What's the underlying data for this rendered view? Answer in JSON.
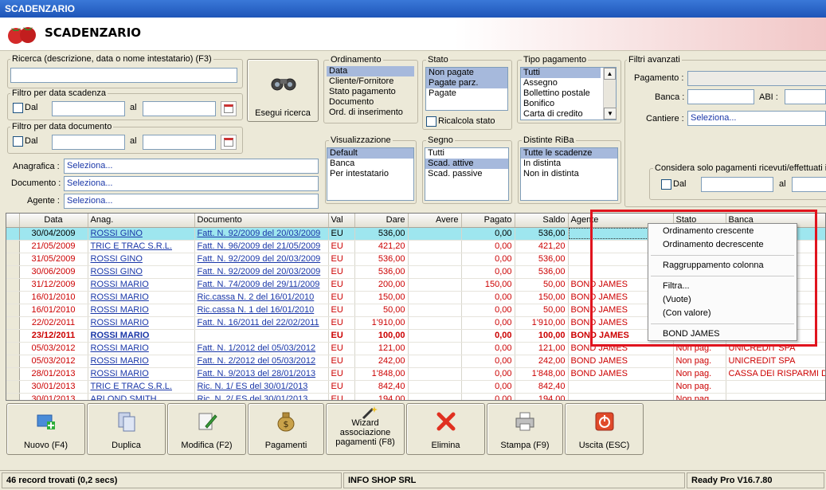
{
  "window": {
    "title": "SCADENZARIO"
  },
  "header": {
    "title": "SCADENZARIO"
  },
  "search": {
    "label": "Ricerca (descrizione, data o nome intestatario) (F3)",
    "value": "",
    "button_label": "Esegui ricerca"
  },
  "filter_due": {
    "label": "Filtro per data scadenza",
    "dal": "Dal",
    "al": "al"
  },
  "filter_doc": {
    "label": "Filtro per data documento",
    "dal": "Dal",
    "al": "al"
  },
  "anagrafica": {
    "label": "Anagrafica :",
    "value": "Seleziona..."
  },
  "documento": {
    "label": "Documento :",
    "value": "Seleziona..."
  },
  "agente": {
    "label": "Agente :",
    "value": "Seleziona..."
  },
  "ordinamento": {
    "label": "Ordinamento",
    "items": [
      "Data",
      "Cliente/Fornitore",
      "Stato pagamento",
      "Documento",
      "Ord. di inserimento"
    ],
    "selected": [
      0
    ]
  },
  "stato": {
    "label": "Stato",
    "items": [
      "Non pagate",
      "Pagate parz.",
      "Pagate"
    ],
    "selected": [
      0,
      1
    ],
    "ricalcola": "Ricalcola stato"
  },
  "tipo_pagamento": {
    "label": "Tipo pagamento",
    "items": [
      "Tutti",
      "Assegno",
      "Bollettino postale",
      "Bonifico",
      "Carta di credito"
    ],
    "selected": [
      0
    ]
  },
  "visualizzazione": {
    "label": "Visualizzazione",
    "items": [
      "Default",
      "Banca",
      "Per intestatario"
    ],
    "selected": [
      0
    ]
  },
  "segno": {
    "label": "Segno",
    "items": [
      "Tutti",
      "Scad. attive",
      "Scad. passive"
    ],
    "selected": [
      1
    ]
  },
  "distinte": {
    "label": "Distinte RiBa",
    "items": [
      "Tutte le scadenze",
      "In distinta",
      "Non in distinta"
    ],
    "selected": [
      0
    ]
  },
  "filtri_avanzati": {
    "label": "Filtri avanzati",
    "pagamento": "Pagamento :",
    "banca": "Banca :",
    "abi": "ABI :",
    "cantiere": "Cantiere :",
    "cantiere_value": "Seleziona...",
    "considera": "Considera solo pagamenti ricevuti/effettuati i",
    "dal": "Dal",
    "al": "al"
  },
  "grid": {
    "columns": [
      "Data",
      "Anag.",
      "Documento",
      "Val",
      "Dare",
      "Avere",
      "Pagato",
      "Saldo",
      "Agente",
      "Stato",
      "Banca"
    ],
    "rows": [
      {
        "data": "30/04/2009",
        "anag": "ROSSI GINO",
        "doc": "Fatt. N. 92/2009 del 20/03/2009",
        "val": "EU",
        "dare": "536,00",
        "avere": "",
        "pagato": "0,00",
        "saldo": "536,00",
        "agente": "",
        "stato": "",
        "banca": "",
        "style": "first"
      },
      {
        "data": "21/05/2009",
        "anag": "TRIC E TRAC S.R.L.",
        "doc": "Fatt. N. 96/2009 del 21/05/2009",
        "val": "EU",
        "dare": "421,20",
        "avere": "",
        "pagato": "0,00",
        "saldo": "421,20",
        "agente": "",
        "stato": "",
        "banca": "",
        "style": "r"
      },
      {
        "data": "31/05/2009",
        "anag": "ROSSI GINO",
        "doc": "Fatt. N. 92/2009 del 20/03/2009",
        "val": "EU",
        "dare": "536,00",
        "avere": "",
        "pagato": "0,00",
        "saldo": "536,00",
        "agente": "",
        "stato": "",
        "banca": "",
        "style": "r"
      },
      {
        "data": "30/06/2009",
        "anag": "ROSSI GINO",
        "doc": "Fatt. N. 92/2009 del 20/03/2009",
        "val": "EU",
        "dare": "536,00",
        "avere": "",
        "pagato": "0,00",
        "saldo": "536,00",
        "agente": "",
        "stato": "",
        "banca": "",
        "style": "r"
      },
      {
        "data": "31/12/2009",
        "anag": "ROSSI MARIO",
        "doc": "Fatt. N. 74/2009 del 29/11/2009",
        "val": "EU",
        "dare": "200,00",
        "avere": "",
        "pagato": "150,00",
        "saldo": "50,00",
        "agente": "BOND JAMES",
        "stato": "",
        "banca": "",
        "style": "r"
      },
      {
        "data": "16/01/2010",
        "anag": "ROSSI MARIO",
        "doc": "Ric.cassa N. 2 del 16/01/2010",
        "val": "EU",
        "dare": "150,00",
        "avere": "",
        "pagato": "0,00",
        "saldo": "150,00",
        "agente": "BOND JAMES",
        "stato": "",
        "banca": "",
        "style": "r"
      },
      {
        "data": "16/01/2010",
        "anag": "ROSSI MARIO",
        "doc": "Ric.cassa N. 1 del 16/01/2010",
        "val": "EU",
        "dare": "50,00",
        "avere": "",
        "pagato": "0,00",
        "saldo": "50,00",
        "agente": "BOND JAMES",
        "stato": "",
        "banca": "",
        "style": "r"
      },
      {
        "data": "22/02/2011",
        "anag": "ROSSI MARIO",
        "doc": "Fatt. N. 16/2011 del 22/02/2011",
        "val": "EU",
        "dare": "1'910,00",
        "avere": "",
        "pagato": "0,00",
        "saldo": "1'910,00",
        "agente": "BOND JAMES",
        "stato": "",
        "banca": "",
        "style": "r"
      },
      {
        "data": "23/12/2011",
        "anag": "ROSSI MARIO",
        "doc": "",
        "val": "EU",
        "dare": "100,00",
        "avere": "",
        "pagato": "0,00",
        "saldo": "100,00",
        "agente": "BOND JAMES",
        "stato": "",
        "banca": "",
        "style": "r bold"
      },
      {
        "data": "05/03/2012",
        "anag": "ROSSI MARIO",
        "doc": "Fatt. N. 1/2012 del 05/03/2012",
        "val": "EU",
        "dare": "121,00",
        "avere": "",
        "pagato": "0,00",
        "saldo": "121,00",
        "agente": "BOND JAMES",
        "stato": "Non pag.",
        "banca": "UNICREDIT SPA",
        "style": "r"
      },
      {
        "data": "05/03/2012",
        "anag": "ROSSI MARIO",
        "doc": "Fatt. N. 2/2012 del 05/03/2012",
        "val": "EU",
        "dare": "242,00",
        "avere": "",
        "pagato": "0,00",
        "saldo": "242,00",
        "agente": "BOND JAMES",
        "stato": "Non pag.",
        "banca": "UNICREDIT SPA",
        "style": "r"
      },
      {
        "data": "28/01/2013",
        "anag": "ROSSI MARIO",
        "doc": "Fatt. N. 9/2013 del 28/01/2013",
        "val": "EU",
        "dare": "1'848,00",
        "avere": "",
        "pagato": "0,00",
        "saldo": "1'848,00",
        "agente": "BOND JAMES",
        "stato": "Non pag.",
        "banca": "CASSA DEI RISPARMI D",
        "style": "r"
      },
      {
        "data": "30/01/2013",
        "anag": "TRIC E TRAC S.R.L.",
        "doc": "Ric. N. 1/ ES del 30/01/2013",
        "val": "EU",
        "dare": "842,40",
        "avere": "",
        "pagato": "0,00",
        "saldo": "842,40",
        "agente": "",
        "stato": "Non pag.",
        "banca": "",
        "style": "r"
      },
      {
        "data": "30/01/2013",
        "anag": "ARLOND SMITH",
        "doc": "Ric. N. 2/ ES del 30/01/2013",
        "val": "EU",
        "dare": "194,00",
        "avere": "",
        "pagato": "0,00",
        "saldo": "194,00",
        "agente": "",
        "stato": "Non pag.",
        "banca": "",
        "style": "r"
      }
    ]
  },
  "context_menu": {
    "items": [
      "Ordinamento crescente",
      "Ordinamento decrescente",
      "Raggruppamento colonna",
      "Filtra...",
      "(Vuote)",
      "(Con valore)",
      "BOND JAMES"
    ]
  },
  "toolbar": {
    "nuovo": "Nuovo (F4)",
    "duplica": "Duplica",
    "modifica": "Modifica (F2)",
    "pagamenti": "Pagamenti",
    "wizard": "Wizard associazione pagamenti (F8)",
    "elimina": "Elimina",
    "stampa": "Stampa (F9)",
    "uscita": "Uscita (ESC)"
  },
  "status": {
    "records": "46 record trovati (0,2 secs)",
    "company": "INFO SHOP SRL",
    "version": "Ready Pro V16.7.80"
  }
}
